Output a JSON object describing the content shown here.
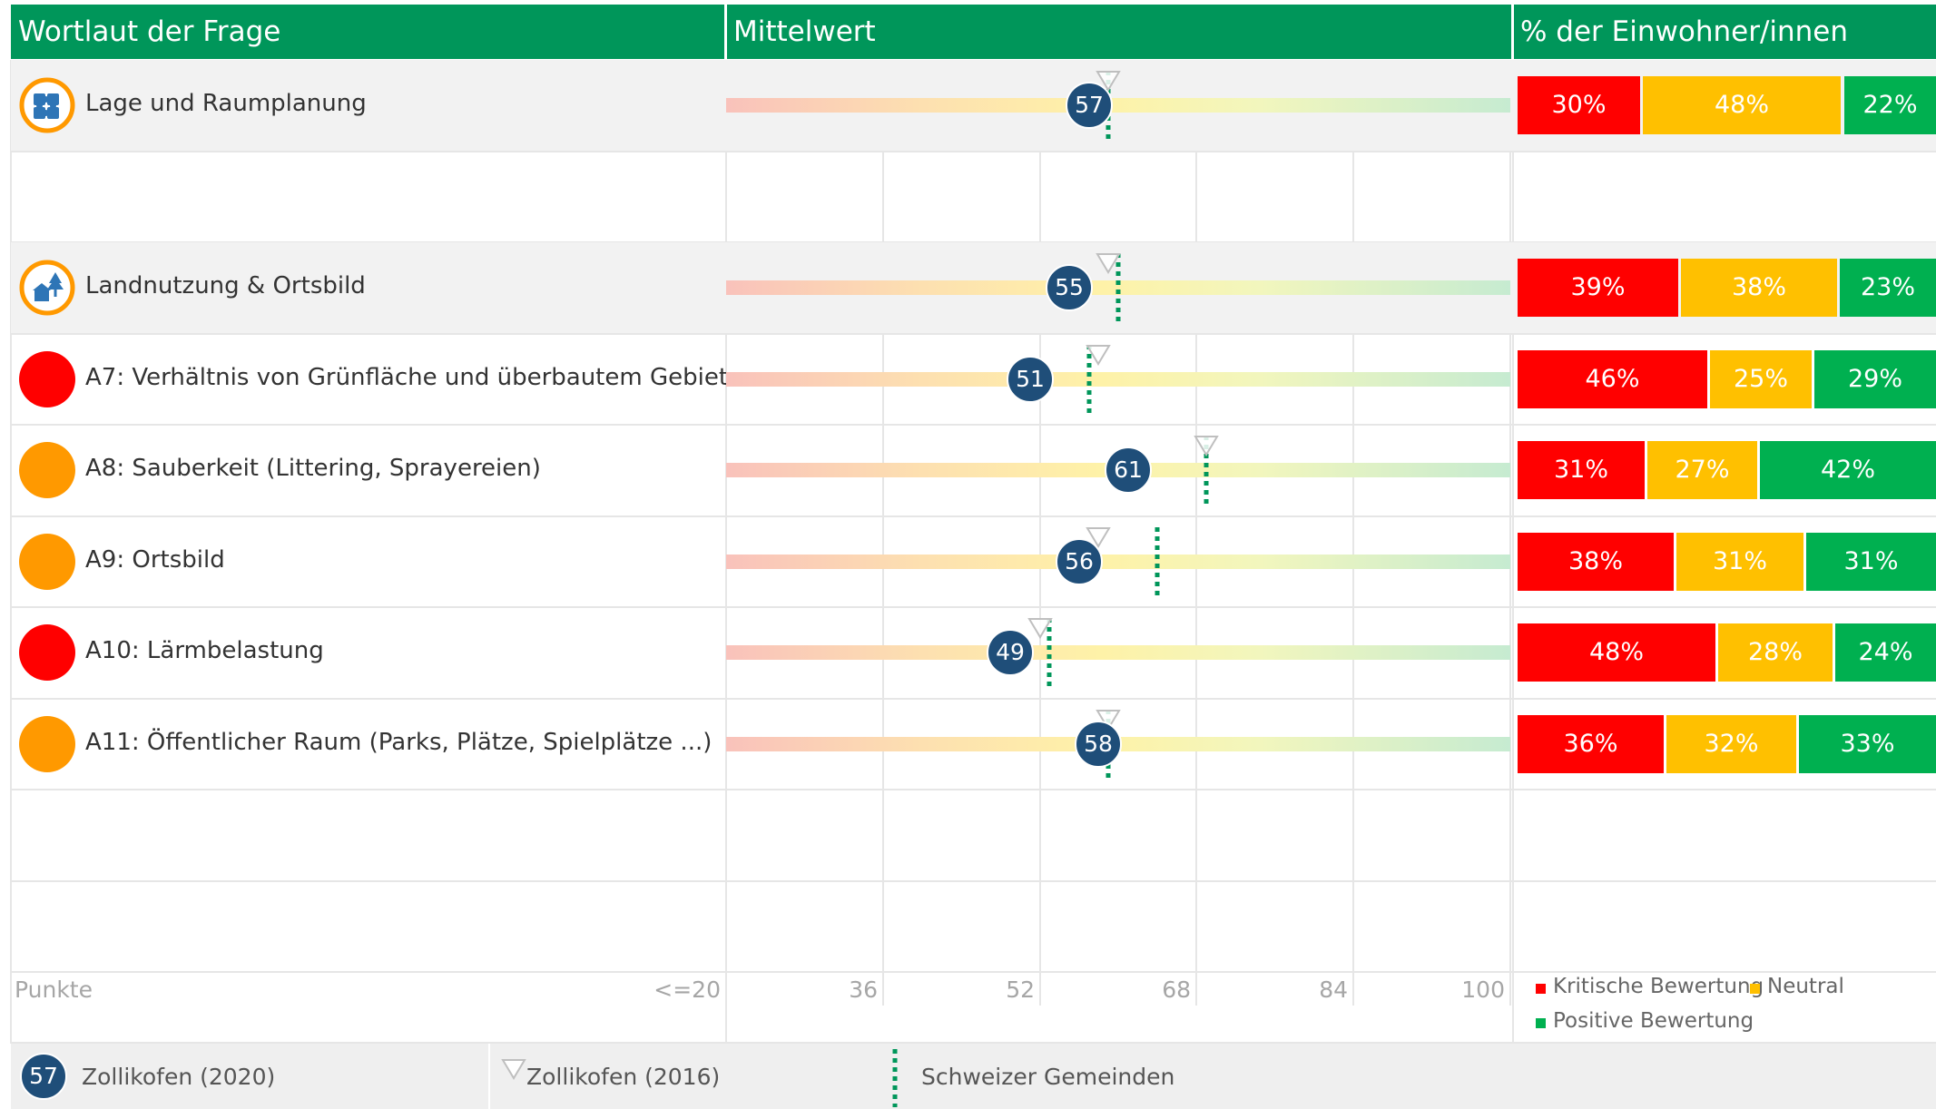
{
  "header": {
    "col1": "Wortlaut der Frage",
    "col2": "Mittelwert",
    "col3": "% der Einwohner/innen"
  },
  "axis": {
    "label": "Punkte",
    "ticks": [
      "<=20",
      "36",
      "52",
      "68",
      "84",
      "100"
    ],
    "min": 20,
    "max": 100
  },
  "legend_pct": {
    "critical": "Kritische Bewertung",
    "neutral": "Neutral",
    "positive": "Positive Bewertung"
  },
  "legend_markers": {
    "circle_value": "57",
    "circle_label": "Zollikofen (2020)",
    "triangle_label": "Zollikofen (2016)",
    "dotted_label": "Schweizer Gemeinden"
  },
  "colors": {
    "header": "#00965a",
    "critical": "#ff0000",
    "neutral": "#ffc000",
    "positive": "#00b050",
    "marker": "#1f4e79",
    "dot_red": "#ff0000",
    "dot_orange": "#ff9900",
    "swiss_line": "#00965a"
  },
  "chart_data": {
    "type": "bar",
    "xlim": [
      20,
      100
    ],
    "rows": [
      {
        "kind": "topic",
        "icon": "puzzle-icon",
        "label": "Lage und Raumplanung",
        "value_2020": 57,
        "value_2016": 59,
        "swiss": 59,
        "critical": 30,
        "neutral": 48,
        "positive": 22
      },
      {
        "kind": "empty"
      },
      {
        "kind": "topic",
        "icon": "house-tree-icon",
        "label": "Landnutzung & Ortsbild",
        "value_2020": 55,
        "value_2016": 59,
        "swiss": 60,
        "critical": 39,
        "neutral": 38,
        "positive": 23
      },
      {
        "kind": "item",
        "dot": "red",
        "label": "A7: Verhältnis von Grünfläche und überbautem Gebiet",
        "value_2020": 51,
        "value_2016": 58,
        "swiss": 57,
        "critical": 46,
        "neutral": 25,
        "positive": 29
      },
      {
        "kind": "item",
        "dot": "orange",
        "label": "A8: Sauberkeit (Littering, Sprayereien)",
        "value_2020": 61,
        "value_2016": 69,
        "swiss": 69,
        "critical": 31,
        "neutral": 27,
        "positive": 42
      },
      {
        "kind": "item",
        "dot": "orange",
        "label": "A9: Ortsbild",
        "value_2020": 56,
        "value_2016": 58,
        "swiss": 64,
        "critical": 38,
        "neutral": 31,
        "positive": 31
      },
      {
        "kind": "item",
        "dot": "red",
        "label": "A10: Lärmbelastung",
        "value_2020": 49,
        "value_2016": 52,
        "swiss": 53,
        "critical": 48,
        "neutral": 28,
        "positive": 24
      },
      {
        "kind": "item",
        "dot": "orange",
        "label": "A11: Öffentlicher Raum (Parks, Plätze, Spielplätze ...)",
        "value_2020": 58,
        "value_2016": 59,
        "swiss": 59,
        "critical": 36,
        "neutral": 32,
        "positive": 33
      },
      {
        "kind": "empty"
      },
      {
        "kind": "empty"
      }
    ]
  }
}
